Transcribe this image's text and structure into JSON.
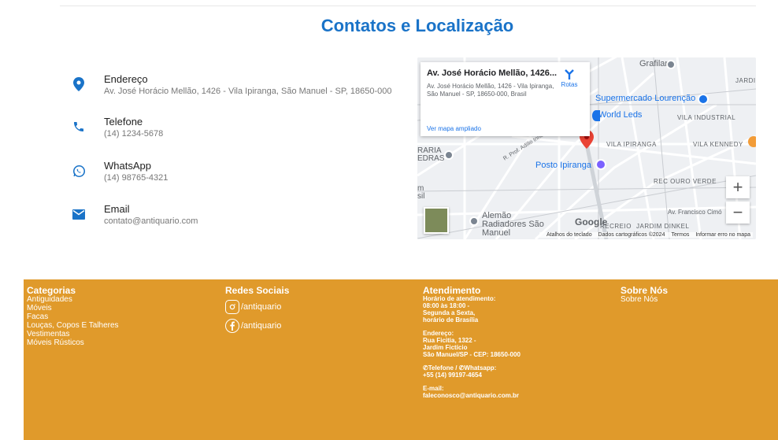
{
  "section": {
    "title": "Contatos e Localização"
  },
  "contacts": [
    {
      "label": "Endereço",
      "value": "Av. José Horácio Mellão, 1426 - Vila Ipiranga, São Manuel - SP, 18650-000"
    },
    {
      "label": "Telefone",
      "value": "(14) 1234-5678"
    },
    {
      "label": "WhatsApp",
      "value": "(14) 98765-4321"
    },
    {
      "label": "Email",
      "value": "contato@antiquario.com"
    }
  ],
  "map": {
    "card_title": "Av. José Horácio Mellão, 1426...",
    "card_address": "Av. José Horácio Mellão, 1426 - Vila Ipiranga, São Manuel - SP, 18650-000, Brasil",
    "card_link": "Ver mapa ampliado",
    "directions_label": "Rotas",
    "places": [
      "Grafilar",
      "Supermercado Lourenção",
      "World Leds",
      "Posto Ipiranga",
      "Alemão Radiadores São Manuel"
    ],
    "neighborhoods": [
      "JARDI",
      "VILA INDUSTRIAL",
      "VILA IPIRANGA",
      "VILA KENNEDY",
      "REC OURO VERDE",
      "RECREIO",
      "JARDIM DINKEL"
    ],
    "streets": [
      "R. Prof. Adílio Innocenti",
      "Av. Francisco Cimó"
    ],
    "partial_labels": [
      "RARIA",
      "EDRAS",
      "m",
      "sil"
    ],
    "zoom_in": "+",
    "zoom_out": "−",
    "logo": "Google",
    "attribution": [
      "Atalhos do teclado",
      "Dados cartográficos ©2024",
      "Termos",
      "Informar erro no mapa"
    ]
  },
  "footer": {
    "categories": {
      "title": "Categorias",
      "items": [
        "Antiguidades",
        "Móveis",
        "Facas",
        "Louças, Copos E Talheres",
        "Vestimentas",
        "Móveis Rústicos"
      ]
    },
    "social": {
      "title": "Redes Sociais",
      "instagram": "/antiquario",
      "facebook": "/antiquario"
    },
    "service": {
      "title": "Atendimento",
      "hours_label": "Horário de atendimento:",
      "hours_1": "08:00 às 18:00 -",
      "hours_2": "Segunda a Sexta,",
      "hours_3": "horário de Brasília",
      "address_label": "Endereço:",
      "address_1": "Rua Ficitia, 1322 -",
      "address_2": "Jardim Fictício",
      "address_3": "São Manuel/SP - CEP: 18650-000",
      "phone_label": "Telefone /",
      "whatsapp_label": "Whatsapp:",
      "phone_value": "+55 (14) 99197-4654",
      "email_label": "E-mail:",
      "email_value": "faleconosco@antiquario.com.br"
    },
    "about": {
      "title": "Sobre Nós",
      "link": "Sobre Nós"
    }
  },
  "colors": {
    "accent": "#1a73c8",
    "footer_bg": "#e09a2b",
    "map_pin": "#ea4335"
  }
}
